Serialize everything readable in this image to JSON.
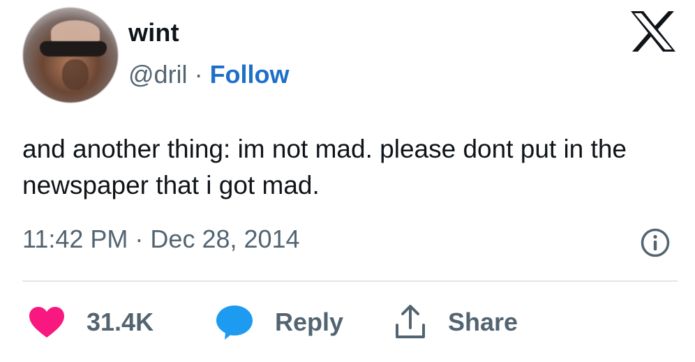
{
  "user": {
    "display_name": "wint",
    "handle": "@dril",
    "separator": "·",
    "follow_label": "Follow"
  },
  "tweet": {
    "text": "and another thing: im not mad. please dont put in the newspaper that i got mad."
  },
  "meta": {
    "time": "11:42 PM",
    "separator": "·",
    "date": "Dec 28, 2014"
  },
  "actions": {
    "likes_count": "31.4K",
    "reply_label": "Reply",
    "share_label": "Share"
  },
  "colors": {
    "heart": "#f91880",
    "reply_bubble": "#1d9bf0",
    "follow": "#1d6fc9",
    "muted_text": "#536471",
    "divider": "#e1e6ea"
  },
  "icons": [
    "x-logo-icon",
    "info-icon",
    "heart-icon",
    "reply-bubble-icon",
    "share-icon"
  ]
}
